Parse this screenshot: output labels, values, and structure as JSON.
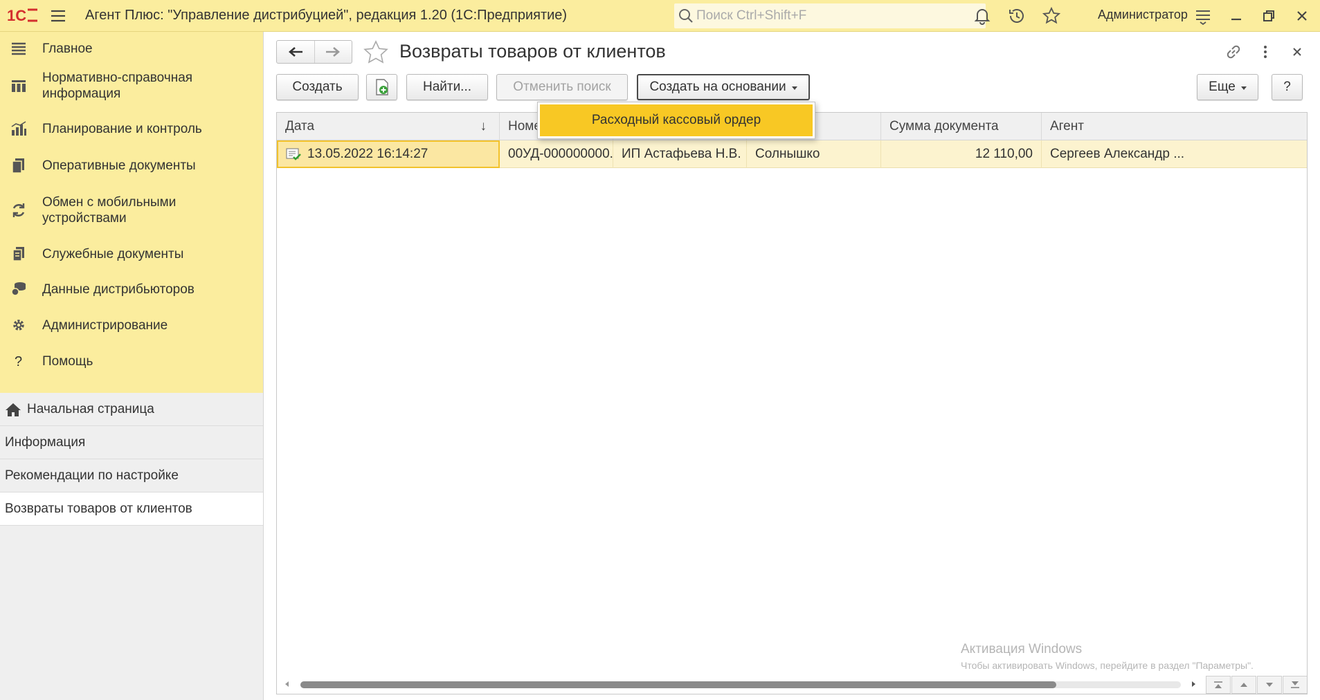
{
  "app": {
    "logo": "1С",
    "title": "Агент Плюс: \"Управление дистрибуцией\", редакция 1.20  (1С:Предприятие)",
    "search_placeholder": "Поиск Ctrl+Shift+F",
    "user": "Администратор",
    "accent_color": "#fbed9e"
  },
  "sidebar": {
    "sections": [
      {
        "label": "Главное",
        "icon": "hamburger-icon"
      },
      {
        "label": "Нормативно-справочная информация",
        "icon": "columns-icon"
      },
      {
        "label": "Планирование и контроль",
        "icon": "bar-chart-icon"
      },
      {
        "label": "Оперативные документы",
        "icon": "documents-icon"
      },
      {
        "label": "Обмен с мобильными устройствами",
        "icon": "refresh-icon"
      },
      {
        "label": "Служебные документы",
        "icon": "service-docs-icon"
      },
      {
        "label": "Данные дистрибьюторов",
        "icon": "database-icon"
      },
      {
        "label": "Администрирование",
        "icon": "gear-icon"
      },
      {
        "label": "Помощь",
        "icon": "question-icon"
      }
    ],
    "pages": [
      {
        "label": "Начальная страница",
        "icon": "home-icon",
        "active": false
      },
      {
        "label": "Информация",
        "active": false
      },
      {
        "label": "Рекомендации по настройке",
        "active": false
      },
      {
        "label": "Возвраты товаров от клиентов",
        "active": true
      }
    ]
  },
  "form": {
    "title": "Возвраты товаров от клиентов",
    "buttons": {
      "create": "Создать",
      "find": "Найти...",
      "cancel_search": "Отменить поиск",
      "create_based": "Создать на основании",
      "more": "Еще",
      "help": "?"
    },
    "dropdown": {
      "items": [
        "Расходный кассовый ордер"
      ]
    }
  },
  "table": {
    "columns": [
      "Дата",
      "Номер",
      "",
      "",
      "Сумма документа",
      "Агент"
    ],
    "sort_indicator": "↓",
    "rows": [
      {
        "date": "13.05.2022 16:14:27",
        "number": "00УД-000000000...",
        "client": "ИП Астафьева Н.В.",
        "outlet": "Солнышко",
        "sum": "12 110,00",
        "agent": "Сергеев Александр ..."
      }
    ]
  },
  "watermark": {
    "line1": "Активация Windows",
    "line2": "Чтобы активировать Windows, перейдите в раздел \"Параметры\"."
  }
}
